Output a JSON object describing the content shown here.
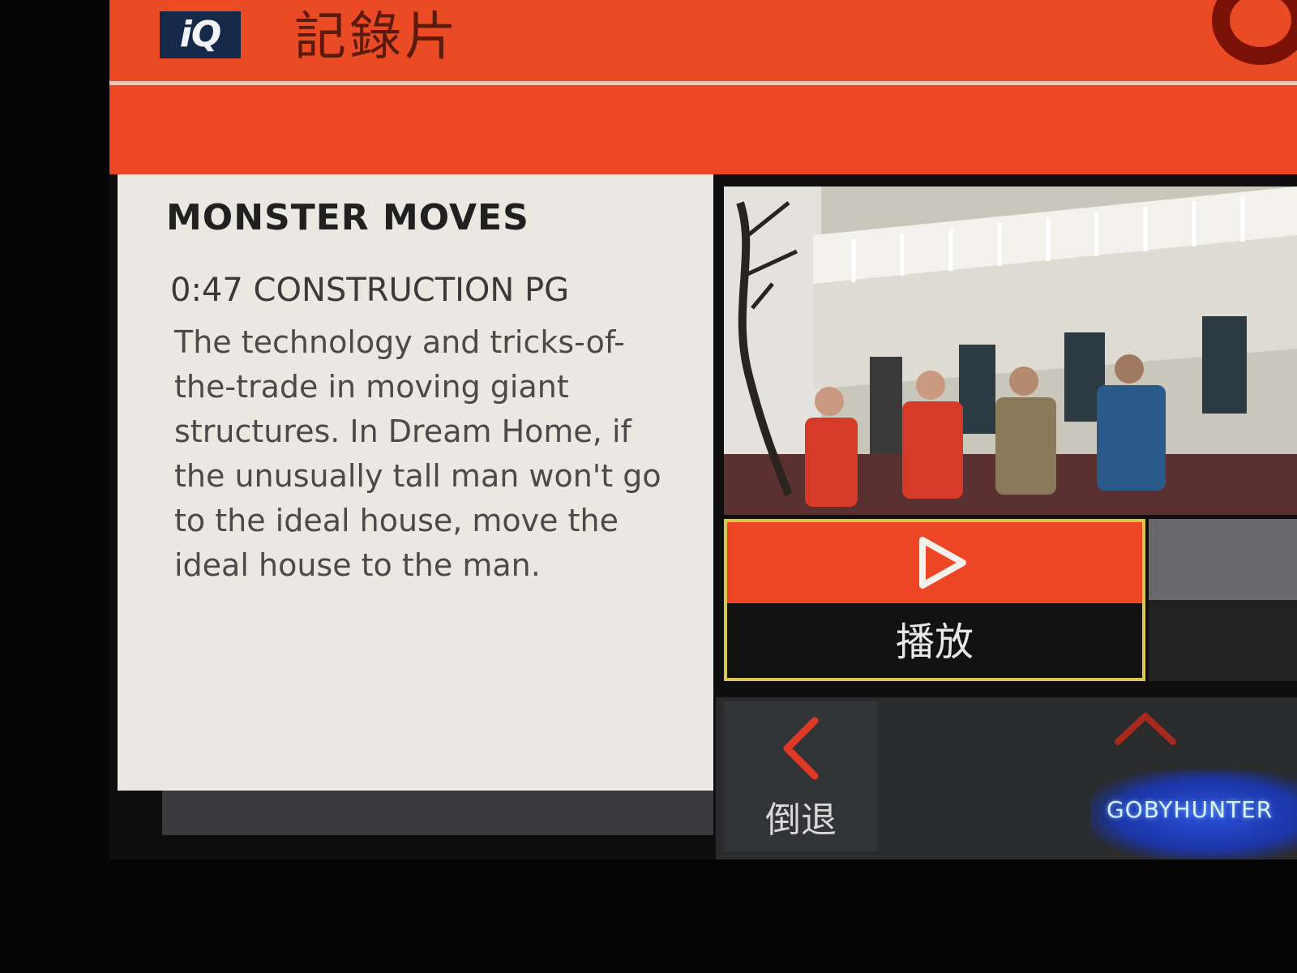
{
  "header": {
    "logo_text": "iQ",
    "title": "記錄片"
  },
  "program": {
    "title": "MONSTER MOVES",
    "meta": "0:47 CONSTRUCTION PG",
    "description": "The technology and tricks-of-the-trade in moving giant structures. In Dream Home, if the unusually tall man won't go to the ideal house, move the ideal house to the man."
  },
  "actions": {
    "play_label": "播放",
    "play_icon": "play-icon",
    "rewind_label": "倒退",
    "rewind_icon": "chevron-left-icon",
    "up_icon": "chevron-up-icon"
  },
  "watermark": {
    "text": "GOBYHUNTER"
  },
  "colors": {
    "accent": "#ec4624",
    "highlight_border": "#d8c850",
    "panel_bg": "#eae8e0",
    "dark_bg": "#2a2b2d"
  }
}
